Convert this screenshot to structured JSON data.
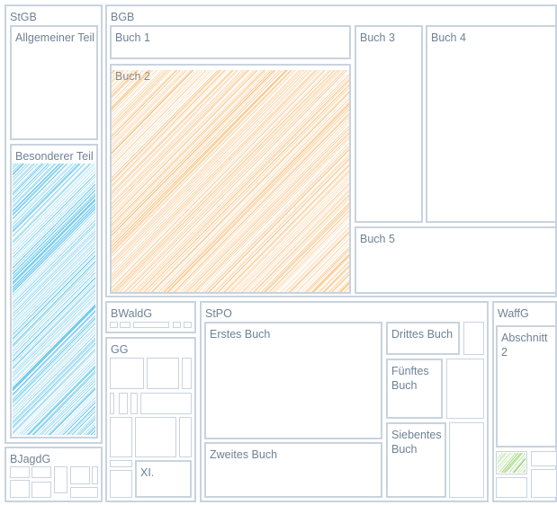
{
  "colors": {
    "border": "#c9d3de",
    "label": "#6f8296",
    "blue_fill": "#38b6e8",
    "orange_fill": "#f7b468",
    "green_fill": "#7ec850"
  },
  "labels": {
    "stgb": "StGB",
    "allgemeiner_teil": "Allgemeiner Teil",
    "besonderer_teil": "Besonderer Teil",
    "bgb": "BGB",
    "buch1": "Buch 1",
    "buch2": "Buch 2",
    "buch3": "Buch 3",
    "buch4": "Buch 4",
    "buch5": "Buch 5",
    "bjagdg": "BJagdG",
    "bwaldg": "BWaldG",
    "gg": "GG",
    "gg_xi": "XI.",
    "stpo": "StPO",
    "erstes_buch": "Erstes Buch",
    "zweites_buch": "Zweites Buch",
    "drittes_buch": "Drittes Buch",
    "fuenftes_buch": "Fünftes Buch",
    "siebentes_buch": "Siebentes Buch",
    "waffg": "WaffG",
    "abschnitt2": "Abschnitt 2"
  }
}
